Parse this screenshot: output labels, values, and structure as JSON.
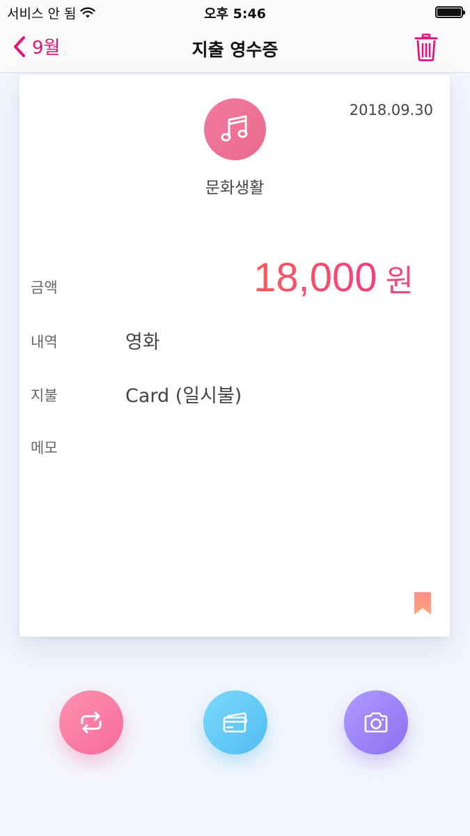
{
  "status_bar": {
    "carrier": "서비스 안 됨",
    "time": "오후 5:46"
  },
  "nav": {
    "back_label": "9월",
    "title": "지출 영수증"
  },
  "receipt": {
    "date": "2018.09.30",
    "category": "문화생활",
    "category_icon": "music-note-icon",
    "fields": {
      "amount_label": "금액",
      "amount_value": "18,000",
      "amount_unit": "원",
      "detail_label": "내역",
      "detail_value": "영화",
      "payment_label": "지불",
      "payment_value": "Card (일시불)",
      "memo_label": "메모",
      "memo_value": ""
    }
  },
  "actions": {
    "icons": [
      "repeat-icon",
      "card-icon",
      "camera-icon"
    ]
  },
  "colors": {
    "accent": "#e3137b",
    "amount_gradient_start": "#ff5a5a",
    "amount_gradient_end": "#f43f7f",
    "category_circle": "#ec7096",
    "bookmark": "#ff9a7a"
  }
}
